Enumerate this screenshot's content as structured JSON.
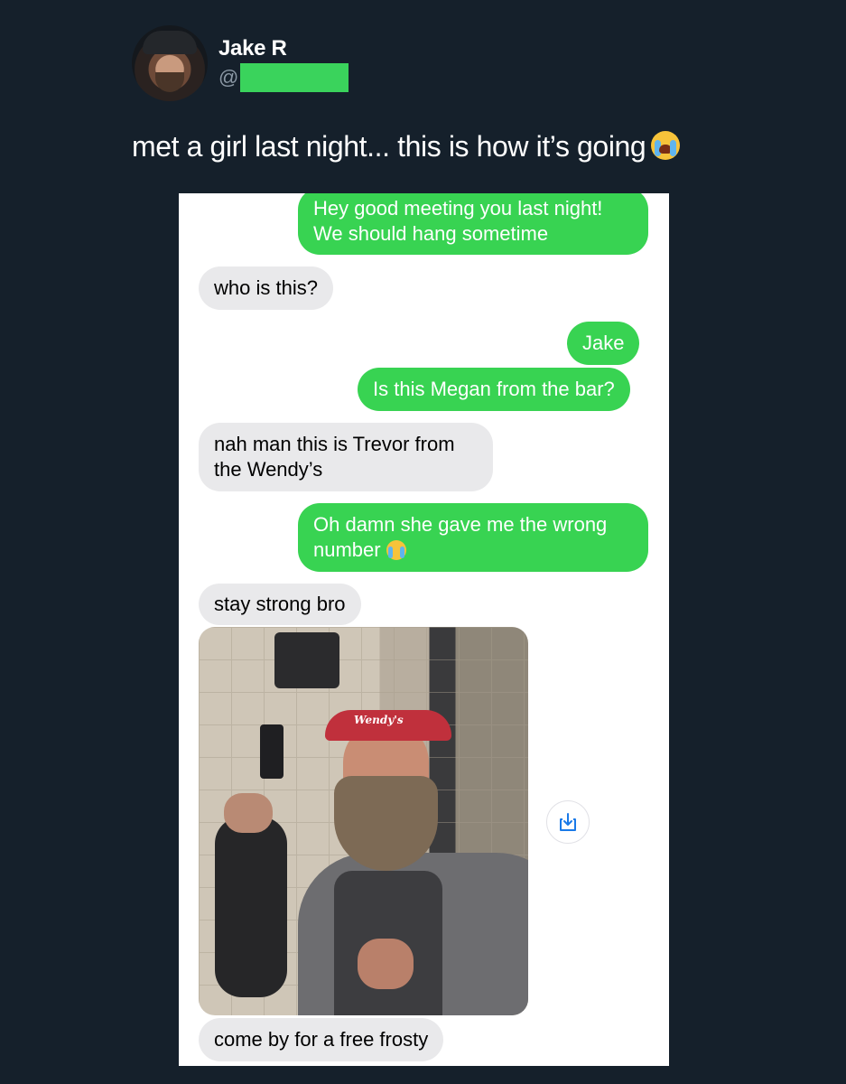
{
  "post": {
    "display_name": "Jake R",
    "handle_prefix": "@",
    "text": "met a girl last night... this is how it’s going",
    "text_emoji": "loudly-crying-face"
  },
  "conversation": {
    "messages": [
      {
        "direction": "outgoing",
        "lines": [
          "Hey good meeting you last night!",
          "We should hang sometime"
        ]
      },
      {
        "direction": "incoming",
        "lines": [
          "who is this?"
        ]
      },
      {
        "direction": "outgoing",
        "lines": [
          "Jake"
        ]
      },
      {
        "direction": "outgoing",
        "lines": [
          "Is this Megan from the bar?"
        ]
      },
      {
        "direction": "incoming",
        "lines": [
          "nah man this is Trevor from",
          "the Wendy’s"
        ]
      },
      {
        "direction": "outgoing",
        "lines": [
          "Oh damn she gave me the wrong",
          "number"
        ],
        "emoji": "loudly-crying-face"
      },
      {
        "direction": "incoming",
        "lines": [
          "stay strong bro"
        ]
      },
      {
        "direction": "incoming",
        "type": "photo",
        "photo_visor_text": "Wendy's"
      },
      {
        "direction": "incoming",
        "lines": [
          "come by for a free frosty"
        ]
      }
    ]
  },
  "colors": {
    "background": "#15202b",
    "outgoing_bubble": "#38d352",
    "incoming_bubble": "#e9e9eb",
    "redaction": "#3ad35c"
  },
  "icons": {
    "download": "download-icon"
  }
}
